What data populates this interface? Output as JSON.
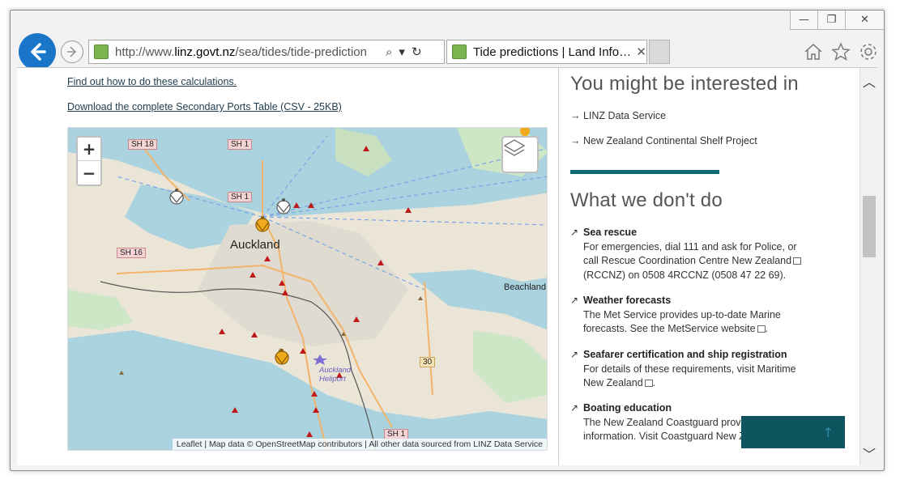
{
  "browser": {
    "url_prefix": "http://www.",
    "url_domain": "linz.govt.nz",
    "url_path": "/sea/tides/tide-prediction",
    "tab_title": "Tide predictions | Land Info…",
    "win_min": "—",
    "win_max": "❐",
    "win_close": "✕",
    "search_icon": "⌕",
    "dropdown_icon": "▾",
    "refresh_icon": "↻",
    "tab_close": "✕"
  },
  "left": {
    "link1": "Find out how to do these calculations.",
    "link2": "Download the complete Secondary Ports Table (CSV - 25KB)",
    "zoom_in": "+",
    "zoom_out": "−",
    "attribution": "Leaflet | Map data © OpenStreetMap contributors | All other data sourced from LINZ Data Service",
    "labels": {
      "city": "Auckland",
      "beachland": "Beachland",
      "heliport": "Auckland Heliport",
      "sh18": "SH 18",
      "sh1_top": "SH 1",
      "sh1_mid": "SH 1",
      "sh16": "SH 16",
      "sh1_bot": "SH 1",
      "r30": "30"
    }
  },
  "sidebar": {
    "heading1": "You might be interested in",
    "links": [
      {
        "arrow": "→",
        "label": "LINZ Data Service"
      },
      {
        "arrow": "→",
        "label": "New Zealand Continental Shelf Project"
      }
    ],
    "heading2": "What we don't do",
    "items": [
      {
        "arrow": "↗",
        "title": "Sea rescue",
        "body": "For emergencies, dial 111 and ask for Police, or call Rescue Coordination Centre New Zealand",
        "body2": "(RCCNZ) on 0508 4RCCNZ (0508 47 22 69)."
      },
      {
        "arrow": "↗",
        "title": "Weather forecasts",
        "body": "The Met Service provides up-to-date Marine forecasts. See the MetService website",
        "body2": "."
      },
      {
        "arrow": "↗",
        "title": "Seafarer certification and ship registration",
        "body": "For details of these requirements, visit Maritime New Zealand",
        "body2": "."
      },
      {
        "arrow": "↗",
        "title": "Boating education",
        "body": "The New Zealand Coastguard provides boating information. Visit Coastguard New Zealand",
        "body2": "."
      }
    ],
    "totop_icon": "↑",
    "scroll_up": "︿",
    "scroll_down": "﹀"
  }
}
